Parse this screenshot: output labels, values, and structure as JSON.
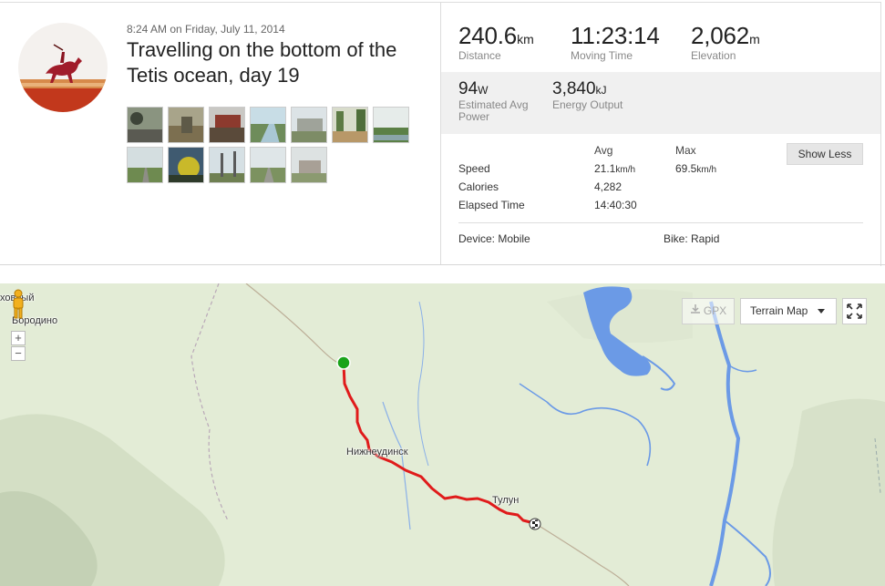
{
  "activity": {
    "timestamp": "8:24 AM on Friday, July 11, 2014",
    "title": "Travelling on the bottom of the Tetis ocean, day 19"
  },
  "stats": {
    "distance": {
      "value": "240.6",
      "unit": "km",
      "label": "Distance"
    },
    "moving_time": {
      "value": "11:23:14",
      "label": "Moving Time"
    },
    "elevation": {
      "value": "2,062",
      "unit": "m",
      "label": "Elevation"
    },
    "power": {
      "value": "94",
      "unit": "W",
      "label_line1": "Estimated Avg",
      "label_line2": "Power"
    },
    "energy": {
      "value": "3,840",
      "unit": "kJ",
      "label": "Energy Output"
    }
  },
  "details": {
    "avg_header": "Avg",
    "max_header": "Max",
    "rows": [
      {
        "label": "Speed",
        "avg": "21.1",
        "avg_unit": "km/h",
        "max": "69.5",
        "max_unit": "km/h"
      },
      {
        "label": "Calories",
        "avg": "4,282"
      },
      {
        "label": "Elapsed Time",
        "avg": "14:40:30"
      }
    ],
    "show_less_label": "Show Less",
    "device": "Device: Mobile",
    "bike": "Bike: Rapid"
  },
  "photos": {
    "count": 13
  },
  "map": {
    "gpx_label": "GPX",
    "map_type_label": "Terrain Map",
    "zoom_in": "+",
    "zoom_out": "−",
    "labels": {
      "town_1": "Нижнеудинск",
      "town_2": "Тулун",
      "corner_1": "ховный",
      "corner_2": "Бородино"
    }
  },
  "colors": {
    "route": "#e01b1b",
    "start_marker": "#1aa31a",
    "water": "#6b9ae6",
    "terrain": "#e3ecd6"
  },
  "icons": {
    "download": "download-icon",
    "dropdown": "caret-down-icon",
    "fullscreen": "fullscreen-icon",
    "pegman": "pegman-icon",
    "finish": "checkered-flag-icon"
  }
}
